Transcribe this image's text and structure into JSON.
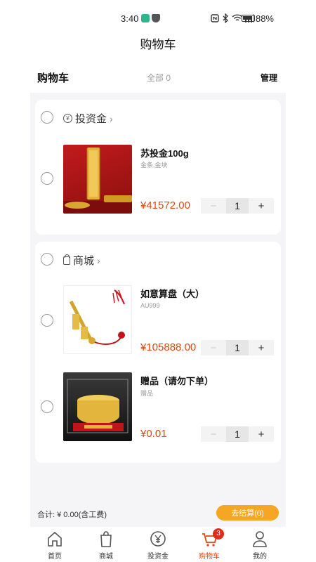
{
  "status_bar": {
    "time": "3:40",
    "battery": "88%",
    "icons": [
      "nfc-icon",
      "bluetooth-icon",
      "wifi-icon",
      "signal-icon",
      "battery-icon"
    ]
  },
  "page_title": "购物车",
  "cart_header": {
    "title": "购物车",
    "count_label": "全部 0",
    "manage_label": "管理"
  },
  "stores": [
    {
      "name": "投资金",
      "icon": "yen-icon",
      "items": [
        {
          "name": "苏投金100g",
          "desc": "金条,金块",
          "price": "¥41572.00",
          "qty": "1",
          "image": "gold-bar-image"
        }
      ]
    },
    {
      "name": "商城",
      "icon": "bag-icon",
      "items": [
        {
          "name": "如意算盘（大）",
          "desc": "AU999",
          "price": "¥105888.00",
          "qty": "1",
          "image": "gold-abacus-image"
        },
        {
          "name": "赠品（请勿下单）",
          "desc": "赠品",
          "price": "¥0.01",
          "qty": "1",
          "image": "gold-bowl-image"
        }
      ]
    }
  ],
  "stepper": {
    "minus": "−",
    "plus": "+"
  },
  "summary": {
    "total": "合计: ¥ 0.00(含工费)",
    "checkout_label": "去结算(0)"
  },
  "tabbar": {
    "items": [
      {
        "label": "首页",
        "icon": "home-icon"
      },
      {
        "label": "商城",
        "icon": "shopping-bag-icon"
      },
      {
        "label": "投资金",
        "icon": "yen-circle-icon"
      },
      {
        "label": "购物车",
        "icon": "cart-icon",
        "badge": "3",
        "active": true
      },
      {
        "label": "我的",
        "icon": "profile-icon"
      }
    ]
  },
  "colors": {
    "accent": "#e0460f",
    "checkout": "#f5a623",
    "badge": "#e52b18",
    "background": "#f5f5f7"
  }
}
